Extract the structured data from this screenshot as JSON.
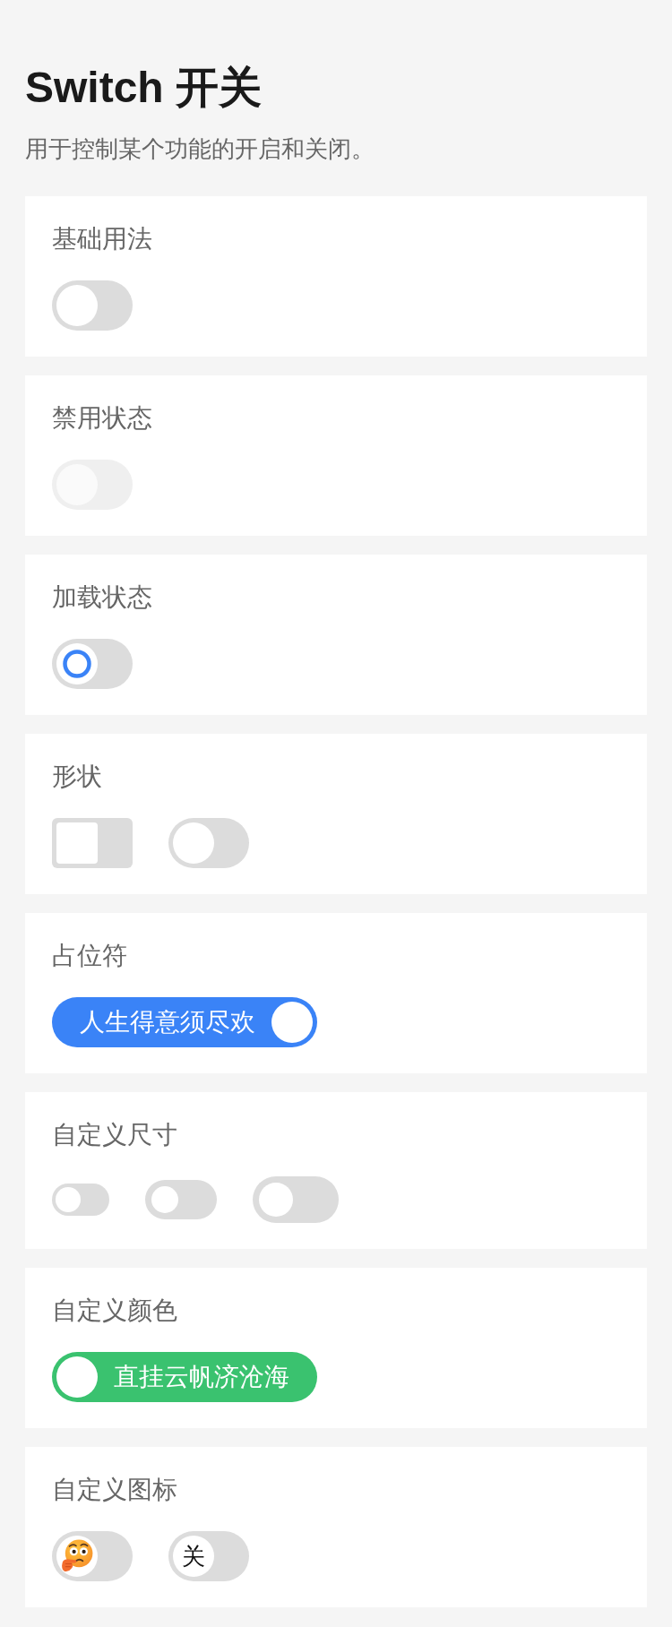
{
  "title": "Switch 开关",
  "subtitle": "用于控制某个功能的开启和关闭。",
  "sections": [
    {
      "heading": "基础用法",
      "switches": [
        {
          "kind": "plain",
          "checked": false,
          "disabled": false
        }
      ]
    },
    {
      "heading": "禁用状态",
      "switches": [
        {
          "kind": "plain",
          "checked": false,
          "disabled": true
        }
      ]
    },
    {
      "heading": "加载状态",
      "switches": [
        {
          "kind": "loading",
          "checked": false,
          "disabled": false
        }
      ]
    },
    {
      "heading": "形状",
      "switches": [
        {
          "kind": "square",
          "checked": false,
          "disabled": false
        },
        {
          "kind": "plain",
          "checked": false,
          "disabled": false
        }
      ]
    },
    {
      "heading": "占位符",
      "switches": [
        {
          "kind": "labeled",
          "text": "人生得意须尽欢",
          "checked": true,
          "disabled": false
        }
      ]
    },
    {
      "heading": "自定义尺寸",
      "switches": [
        {
          "kind": "small",
          "checked": false,
          "disabled": false
        },
        {
          "kind": "medium",
          "checked": false,
          "disabled": false
        },
        {
          "kind": "large",
          "checked": false,
          "disabled": false
        }
      ]
    },
    {
      "heading": "自定义颜色",
      "switches": [
        {
          "kind": "labeled",
          "text": "直挂云帆济沧海",
          "color": "#3ac26f",
          "checked": false,
          "disabled": false
        }
      ]
    },
    {
      "heading": "自定义图标",
      "switches": [
        {
          "kind": "emoji",
          "checked": false,
          "disabled": false
        },
        {
          "kind": "glyph",
          "text": "关",
          "checked": false,
          "disabled": false
        }
      ]
    }
  ]
}
